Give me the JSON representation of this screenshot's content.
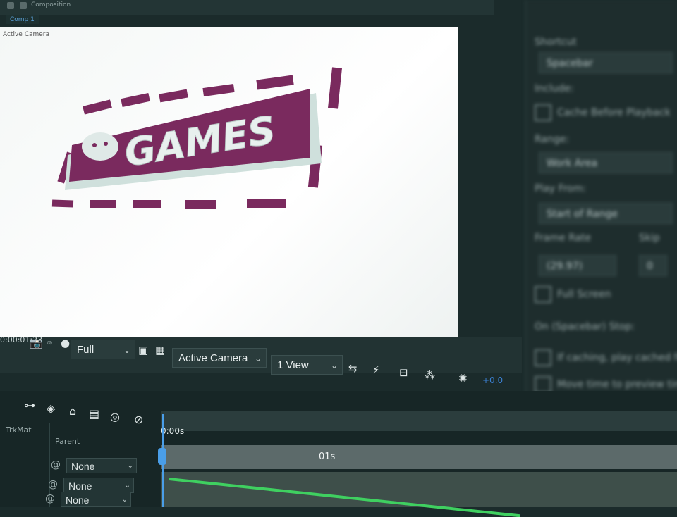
{
  "window": {
    "title": "Composition",
    "comp_tab": "Comp 1"
  },
  "viewer": {
    "camera_label": "Active Camera",
    "logo_text": "GAMES"
  },
  "toolbar": {
    "timecode": "0:00:01:23",
    "resolution": "Full",
    "camera": "Active Camera",
    "views": "1 View",
    "exposure": "+0.0"
  },
  "right_panel": {
    "rows": [
      "Shortcut",
      "Spacebar",
      "Include:",
      "Cache Before Playback",
      "Range:",
      "Work Area",
      "Play From:",
      "Start of Range",
      "Frame Rate",
      "Skip",
      "(29.97)",
      "0",
      "Full Screen",
      "On (Spacebar) Stop:",
      "If caching, play cached frames",
      "Move time to preview time"
    ]
  },
  "timeline": {
    "col_trkmat": "TrkMat",
    "col_parent": "Parent",
    "parent_values": [
      "None",
      "None",
      "None"
    ],
    "ruler_start": "0:00s",
    "second_mark": "01s"
  },
  "colors": {
    "logo_magenta": "#7a2a5e",
    "logo_rim": "#cfe0dc",
    "accent_blue": "#4a9ee8",
    "playhead_green": "#3fd060"
  }
}
